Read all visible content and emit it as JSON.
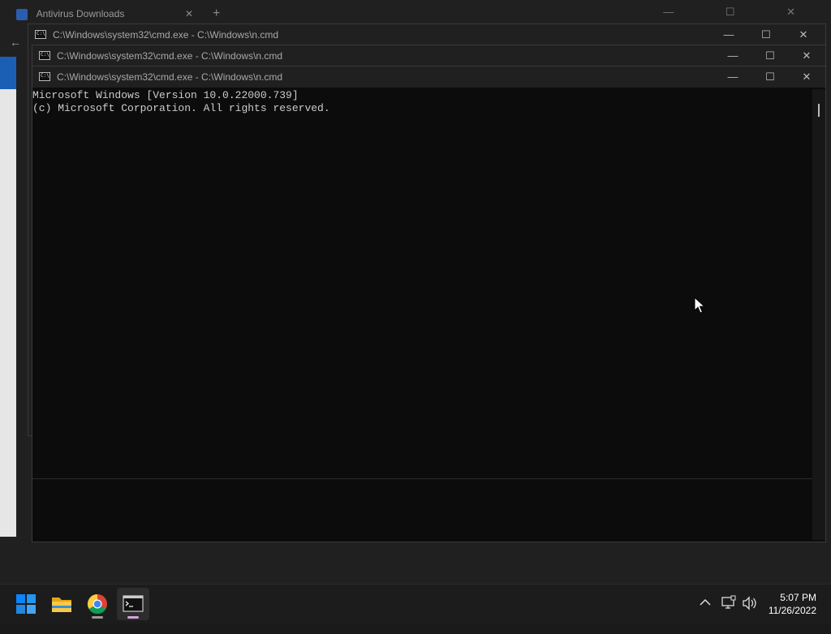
{
  "background_browser": {
    "tab_title": "Antivirus Downloads",
    "tab_close": "✕",
    "new_tab": "+"
  },
  "windows": [
    {
      "title": "C:\\Windows\\system32\\cmd.exe - C:\\Windows\\n.cmd"
    },
    {
      "title": "C:\\Windows\\system32\\cmd.exe - C:\\Windows\\n.cmd"
    },
    {
      "title": "C:\\Windows\\system32\\cmd.exe - C:\\Windows\\n.cmd"
    }
  ],
  "window_controls": {
    "minimize": "—",
    "maximize": "☐",
    "close": "✕"
  },
  "console": {
    "lines": [
      "Microsoft Windows [Version 10.0.22000.739]",
      "(c) Microsoft Corporation. All rights reserved."
    ]
  },
  "taskbar": {
    "apps": [
      {
        "name": "windows-start-icon"
      },
      {
        "name": "file-explorer-icon"
      },
      {
        "name": "chrome-icon"
      },
      {
        "name": "terminal-icon"
      }
    ],
    "tray_chevron": "^",
    "time": "5:07 PM",
    "date": "11/26/2022"
  },
  "colors": {
    "console_bg": "#0c0c0c",
    "console_text": "#cccccc",
    "titlebar_bg": "#202020",
    "taskbar_bg": "#1c1c1c",
    "start_blue": "#0078d4"
  }
}
